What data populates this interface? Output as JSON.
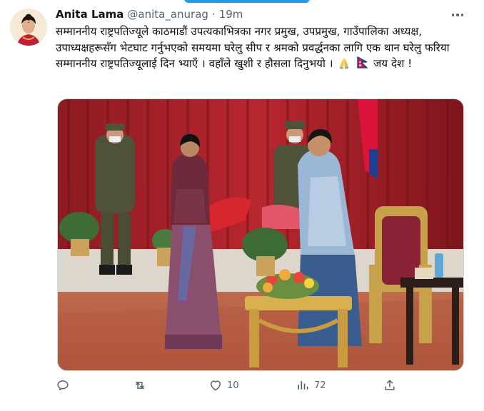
{
  "tweet": {
    "author_name": "Anita Lama",
    "author_handle": "@anita_anurag",
    "separator": "·",
    "timestamp": "19m",
    "text_main": "सम्माननीय राष्ट्रपतिज्यूले काठमाडौं उपत्यकाभित्रका नगर प्रमुख, उपप्रमुख, गाउँपालिका अध्यक्ष, उपाध्यक्षहरूसँग भेटघाट गर्नुभएको समयमा घरेलु सीप र श्रमको प्रवर्द्धनका लागि एक थान घरेलु फरिया सम्माननीय राष्ट्रपतिज्यूलाई दिन भ्याएँ । वहाँले खुशी र हौसला दिनुभयो ।",
    "text_end": " जय देश !",
    "emojis": [
      "folded-hands-icon",
      "nepal-flag-icon"
    ],
    "media_alt": "Photo"
  },
  "actions": {
    "reply_count": "",
    "retweet_count": "",
    "like_count": "10",
    "views_count": "72"
  },
  "colors": {
    "accent": "#1d9bf0",
    "secondary_text": "#536471",
    "primary_text": "#0f1419",
    "border": "#cfd9de"
  }
}
